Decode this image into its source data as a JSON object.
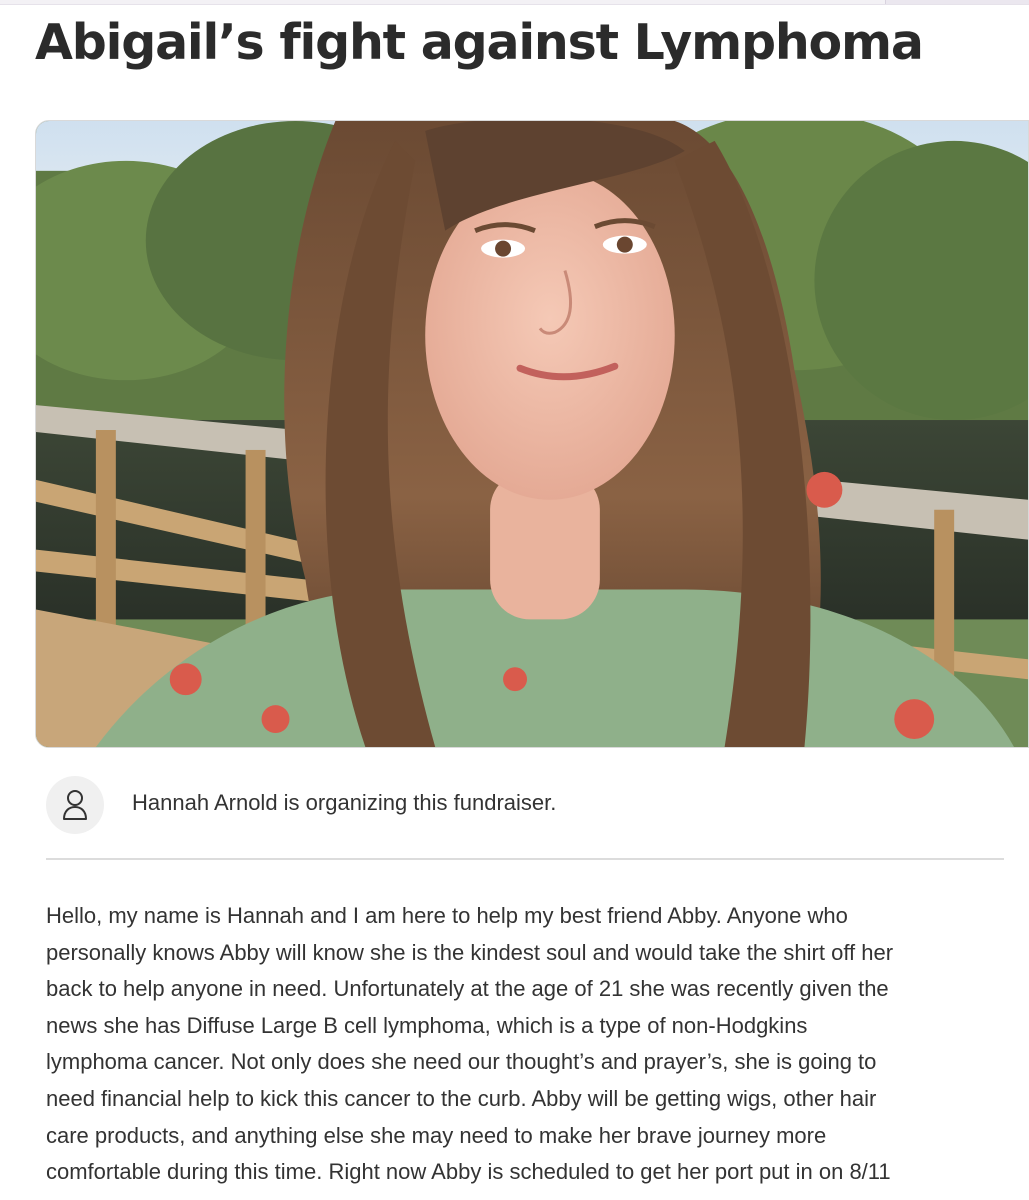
{
  "page": {
    "title": "Abigail’s fight against Lymphoma"
  },
  "hero_image": {
    "description_icon": "fundraiser-photo"
  },
  "organizer": {
    "icon": "user-icon",
    "text": "Hannah Arnold is organizing this fundraiser."
  },
  "story": {
    "lines": [
      "Hello, my name is Hannah and I am here to help my best friend Abby. Anyone who",
      "personally knows Abby will know she is the kindest soul and would take the shirt off her",
      "back to help anyone in need. Unfortunately at the age of 21 she was recently given the",
      "news she has Diffuse Large B cell lymphoma, which is a type of non-Hodgkins",
      "lymphoma cancer. Not only does she need our thought’s and prayer’s, she is going to",
      "need financial help to kick this cancer to the curb. Abby will be getting wigs, other hair",
      "care products, and anything else she may need to make her brave journey more",
      "comfortable during this time. Right now Abby is scheduled to get her port put in on 8/11"
    ]
  },
  "colors": {
    "text": "#333333",
    "divider": "#dcdcdc",
    "avatar_bg": "#f0f0f0"
  }
}
